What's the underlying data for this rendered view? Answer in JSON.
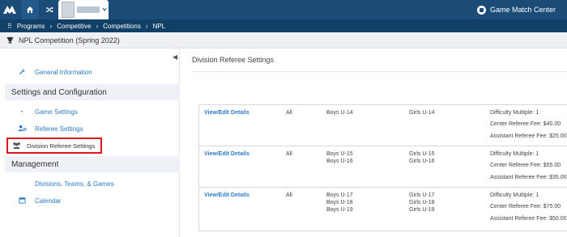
{
  "header": {
    "app_right_label": "Game Match Center",
    "home_icon": "home-icon",
    "shuffle_icon": "shuffle-icon",
    "colors": {
      "topbar": "#1b4c77",
      "crumbbar": "#123f66",
      "link": "#2d7bc4",
      "highlight": "#e0161e"
    }
  },
  "breadcrumb": [
    "Programs",
    "Competitive",
    "Competitions",
    "NPL"
  ],
  "page": {
    "title": "NPL Competition (Spring 2022)"
  },
  "sidebar": {
    "general_info": "General Information",
    "settings_header": "Settings and Configuration",
    "game_settings": "Game Settings",
    "referee_settings": "Referee Settings",
    "division_referee_settings": "Division Referee Settings",
    "management_header": "Management",
    "divisions_teams_games": "Divisions, Teams, & Games",
    "calendar": "Calendar"
  },
  "main": {
    "title": "Division Referee Settings",
    "rows": [
      {
        "action": "View/Edit Details",
        "scope": "All",
        "boys": "Boys U-14",
        "girls": "Girls U-14",
        "difficulty": "Difficulty Multiple: 1",
        "center_fee": "Center Referee Fee: $40.00",
        "assistant_fee": "Assistant Referee Fee: $25.00"
      },
      {
        "action": "View/Edit Details",
        "scope": "All",
        "boys": "Boys U-15\nBoys U-16",
        "girls": "Girls U-15\nGirls U-16",
        "difficulty": "Difficulty Multiple: 1",
        "center_fee": "Center Referee Fee: $55.00",
        "assistant_fee": "Assistant Referee Fee: $35.00"
      },
      {
        "action": "View/Edit Details",
        "scope": "All",
        "boys": "Boys U-17\nBoys U-18\nBoys U-19",
        "girls": "Girls U-17\nGirls U-18\nGirls U-19",
        "difficulty": "Difficulty Multiple: 1",
        "center_fee": "Center Referee Fee: $75.00",
        "assistant_fee": "Assistant Referee Fee: $50.00"
      }
    ]
  }
}
